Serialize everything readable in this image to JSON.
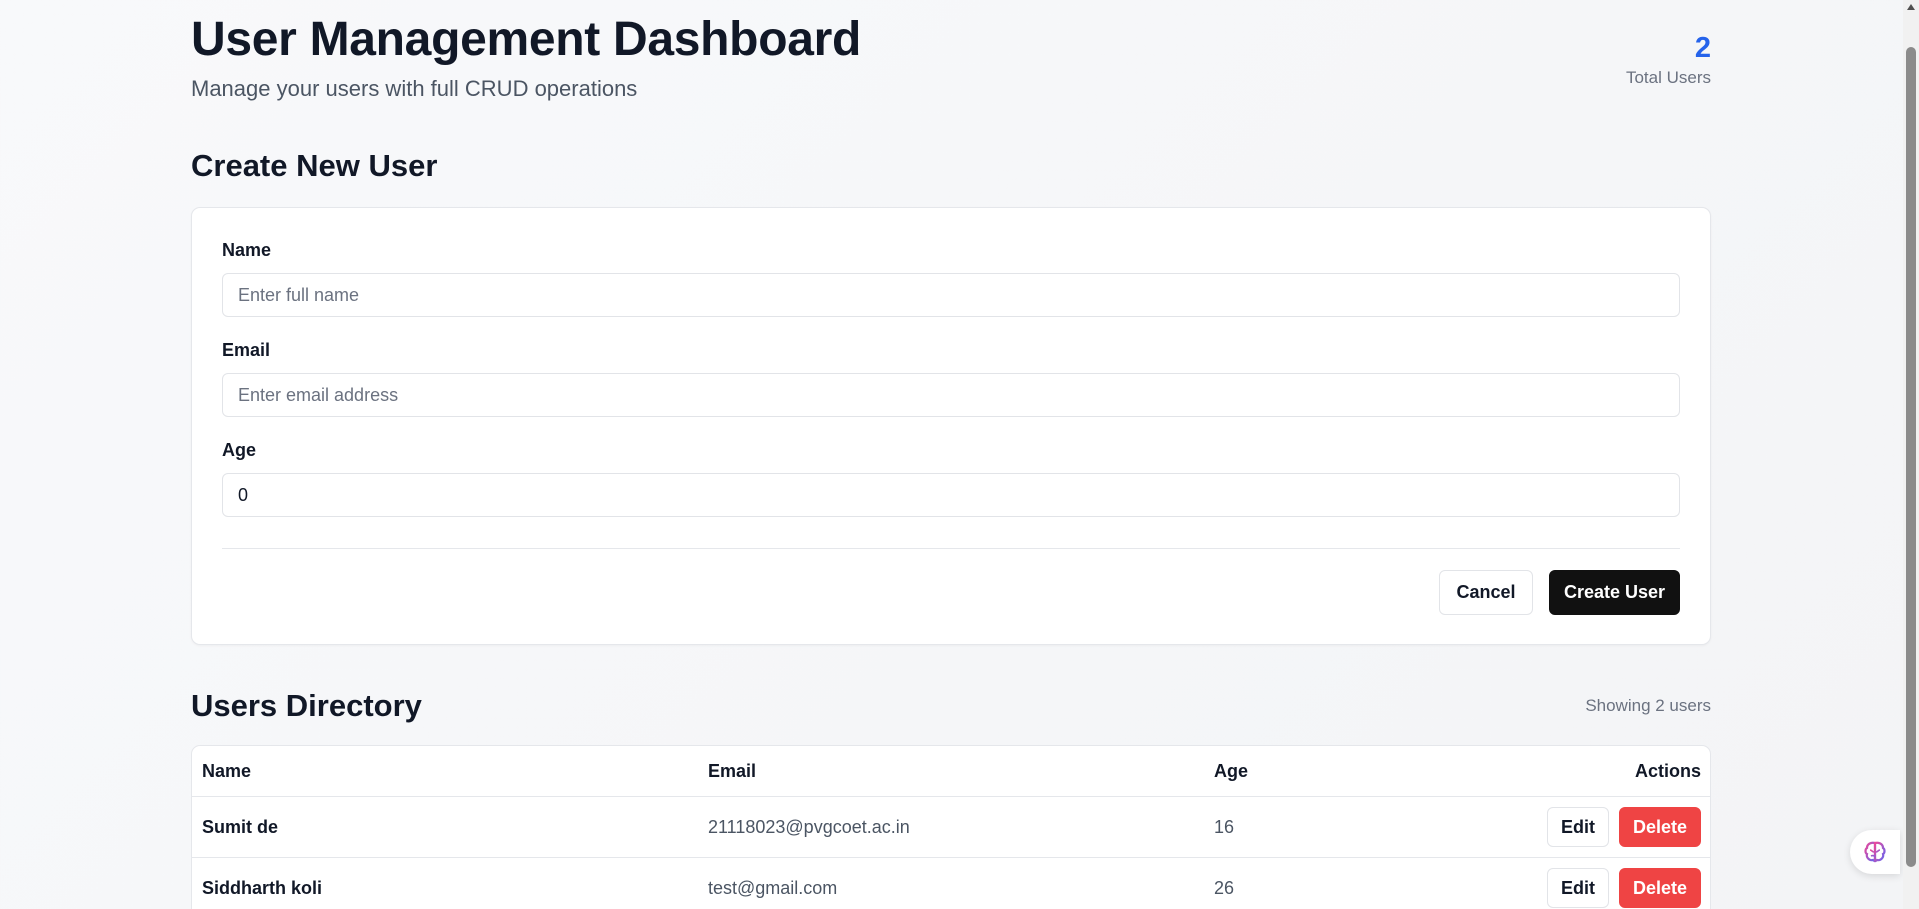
{
  "header": {
    "title": "User Management Dashboard",
    "subtitle": "Manage your users with full CRUD operations",
    "stat_value": "2",
    "stat_label": "Total Users"
  },
  "create_form": {
    "title": "Create New User",
    "name_label": "Name",
    "name_placeholder": "Enter full name",
    "name_value": "",
    "email_label": "Email",
    "email_placeholder": "Enter email address",
    "email_value": "",
    "age_label": "Age",
    "age_value": "0",
    "cancel_label": "Cancel",
    "submit_label": "Create User"
  },
  "directory": {
    "title": "Users Directory",
    "showing_text": "Showing 2 users",
    "columns": [
      "Name",
      "Email",
      "Age",
      "Actions"
    ],
    "rows": [
      {
        "name": "Sumit de",
        "email": "21118023@pvgcoet.ac.in",
        "age": "16"
      },
      {
        "name": "Siddharth koli",
        "email": "test@gmail.com",
        "age": "26"
      }
    ],
    "edit_label": "Edit",
    "delete_label": "Delete"
  },
  "colors": {
    "accent": "#2563eb",
    "primary_button": "#111111",
    "danger": "#ef4444"
  },
  "icons": {
    "floating_widget": "brain-icon"
  }
}
